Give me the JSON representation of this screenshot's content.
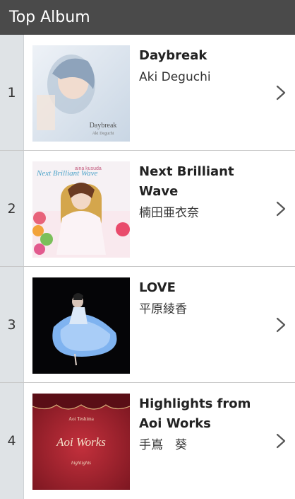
{
  "header": {
    "title": "Top Album"
  },
  "albums": [
    {
      "rank": "1",
      "title": "Daybreak",
      "artist": "Aki Deguchi",
      "cover_text_1": "Daybreak",
      "cover_text_2": "Aki Deguchi"
    },
    {
      "rank": "2",
      "title": "Next Brilliant Wave",
      "artist": "楠田亜衣奈",
      "cover_text_1": "Next Brilliant Wave",
      "cover_text_2": "aina kusuda"
    },
    {
      "rank": "3",
      "title": "LOVE",
      "artist": "平原綾香"
    },
    {
      "rank": "4",
      "title": "Highlights from Aoi Works",
      "artist": "手嶌　葵",
      "cover_text_1": "Aoi Teshima",
      "cover_text_2": "Aoi Works",
      "cover_text_3": "highlights"
    }
  ]
}
